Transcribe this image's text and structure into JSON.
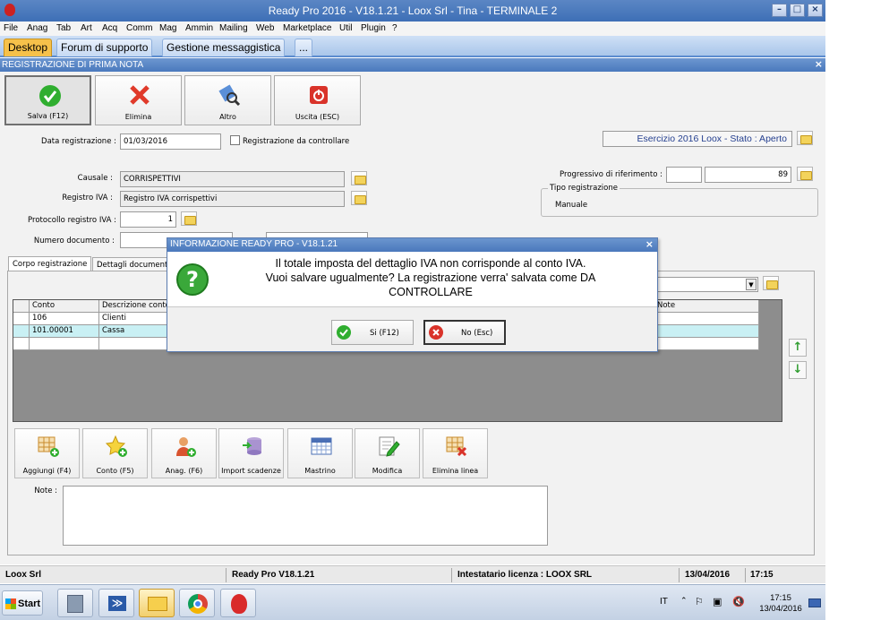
{
  "window": {
    "title": "Ready Pro 2016 - V18.1.21 - Loox Srl - Tina - TERMINALE 2"
  },
  "menu": [
    "File",
    "Anag",
    "Tab",
    "Art",
    "Acq",
    "Comm",
    "Mag",
    "Ammin",
    "Mailing",
    "Web",
    "Marketplace",
    "Util",
    "Plugin",
    "?"
  ],
  "tabs": [
    "Desktop",
    "Forum di supporto",
    "Gestione messaggistica",
    "..."
  ],
  "form": {
    "title": "REGISTRAZIONE DI PRIMA NOTA",
    "toolbar": {
      "save": "Salva (F12)",
      "delete": "Elimina",
      "other": "Altro",
      "exit": "Uscita (ESC)"
    },
    "data_registrazione_label": "Data registrazione :",
    "data_registrazione": "01/03/2016",
    "registrazione_da_controllare": "Registrazione da controllare",
    "esercizio": "Esercizio 2016 Loox - Stato : Aperto",
    "causale_label": "Causale :",
    "causale": "CORRISPETTIVI",
    "registro_iva_label": "Registro IVA :",
    "registro_iva": "Registro IVA corrispettivi",
    "protocollo_label": "Protocollo registro IVA :",
    "protocollo": "1",
    "numero_documento_label": "Numero documento :",
    "progressivo_label": "Progressivo di riferimento :",
    "progressivo_a": "",
    "progressivo_b": "89",
    "tipo_registrazione_label": "Tipo registrazione",
    "tipo_registrazione": "Manuale",
    "subtabs": [
      "Corpo registrazione",
      "Dettagli documento"
    ],
    "grid": {
      "headers": [
        "Conto",
        "Descrizione conto",
        "Note"
      ],
      "rows": [
        {
          "conto": "106",
          "descrizione": "Clienti"
        },
        {
          "conto": "101.00001",
          "descrizione": "Cassa"
        }
      ]
    },
    "actions": {
      "add": "Aggiungi (F4)",
      "account": "Conto (F5)",
      "registry": "Anag. (F6)",
      "import": "Import scadenze",
      "ledger": "Mastrino",
      "edit": "Modifica",
      "delete_line": "Elimina linea"
    },
    "note_label": "Note :"
  },
  "dialog": {
    "title": "INFORMAZIONE READY PRO - V18.1.21",
    "line1": "Il totale imposta del dettaglio IVA non corrisponde al conto IVA.",
    "line2": "Vuoi salvare ugualmente? La registrazione verra' salvata come DA",
    "line3": "CONTROLLARE",
    "yes": "Si (F12)",
    "no": "No (Esc)"
  },
  "statusbar": {
    "company": "Loox Srl",
    "version": "Ready Pro V18.1.21",
    "license": "Intestatario licenza : LOOX SRL",
    "date": "13/04/2016",
    "time": "17:15"
  },
  "taskbar": {
    "start": "Start",
    "lang": "IT",
    "clock_time": "17:15",
    "clock_date": "13/04/2016"
  },
  "colors": {
    "titlebar": "#4a79bd",
    "active_tab": "#f6c14a",
    "selected_row": "#c9f0f4"
  }
}
